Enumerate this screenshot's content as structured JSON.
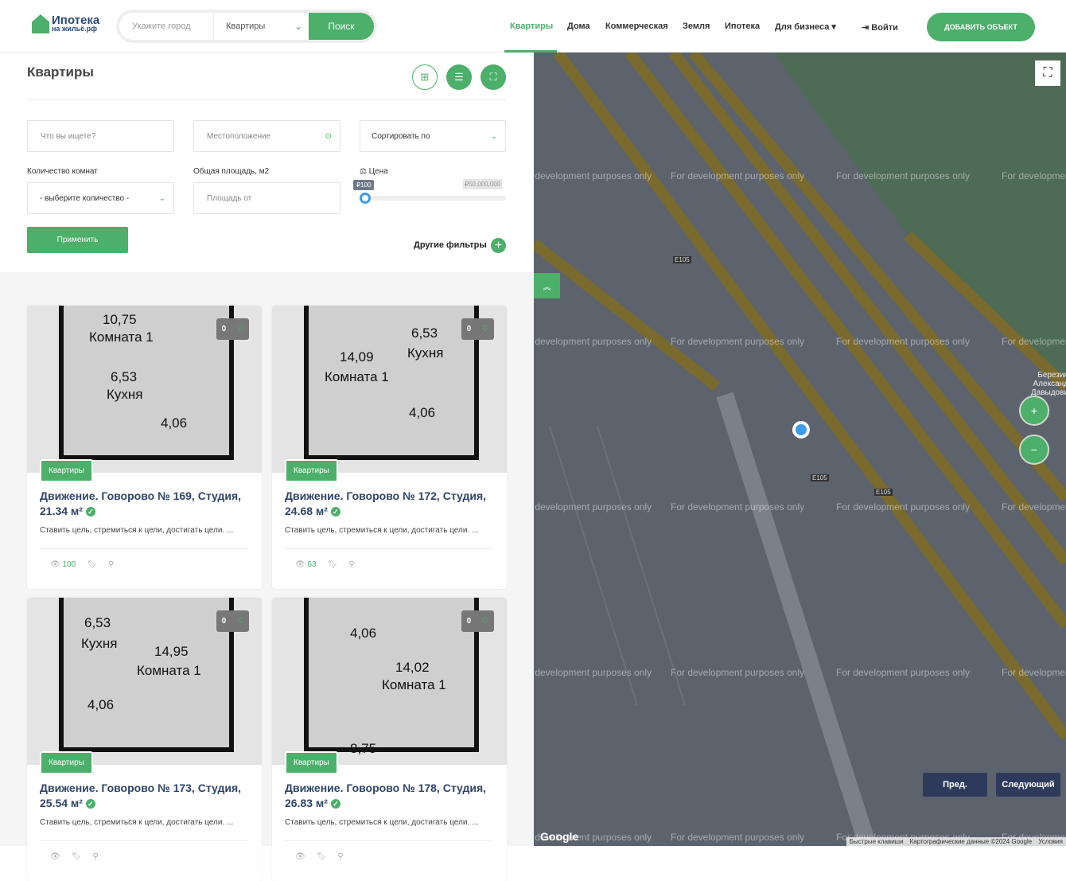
{
  "header": {
    "logo_line1": "Ипотека",
    "logo_line2": "на жильё.рф",
    "city_placeholder": "Укажите город",
    "type_value": "Квартиры",
    "search_label": "Поиск",
    "nav": [
      "Квартиры",
      "Дома",
      "Коммерческая",
      "Земля",
      "Ипотека",
      "Для бизнеса"
    ],
    "login": "Войти",
    "add": "ДОБАВИТЬ ОБЪЕКТ"
  },
  "filters": {
    "title": "Квартиры",
    "what_placeholder": "Что вы ищете?",
    "location_placeholder": "Местоположение",
    "sort": "Сортировать по",
    "rooms_label": "Количество комнат",
    "rooms_value": "- выберите количество -",
    "area_label": "Общая площадь, м2",
    "area_placeholder": "Площадь от",
    "price_label": "Цена",
    "price_min": "₽100",
    "price_max": "₽50,000,000",
    "price_fraction": 0,
    "apply": "Применить",
    "other": "Другие фильтры"
  },
  "cards": [
    {
      "tag": "Квартиры",
      "title": "Движение. Говорово № 169, Студия, 21.34 м²",
      "desc": "Ставить цель, стремиться к цели, достигать цели. ...",
      "views": "100",
      "fav": "0",
      "plan": [
        "10,75",
        "Комната 1",
        "6,53",
        "Кухня",
        "4,06"
      ]
    },
    {
      "tag": "Квартиры",
      "title": "Движение. Говорово № 172, Студия, 24.68 м²",
      "desc": "Ставить цель, стремиться к цели, достигать цели. ...",
      "views": "63",
      "fav": "0",
      "plan": [
        "14,09",
        "Комната 1",
        "6,53",
        "Кухня",
        "4,06"
      ]
    },
    {
      "tag": "Квартиры",
      "title": "Движение. Говорово № 173, Студия, 25.54 м²",
      "desc": "Ставить цель, стремиться к цели, достигать цели. ...",
      "views": "",
      "fav": "0",
      "plan": [
        "6,53",
        "Кухня",
        "14,95",
        "Комната 1",
        "4,06"
      ]
    },
    {
      "tag": "Квартиры",
      "title": "Движение. Говорово № 178, Студия, 26.83 м²",
      "desc": "Ставить цель, стремиться к цели, достигать цели. ...",
      "views": "",
      "fav": "0",
      "plan": [
        "4,06",
        "14,02",
        "Комната 1",
        "8,75",
        ""
      ]
    }
  ],
  "map": {
    "watermark": "For development purposes only",
    "road": "E105",
    "place": "Березин Александ Давыдови",
    "prev": "Пред.",
    "next": "Следующий",
    "google": "Google",
    "attribution": [
      "Быстрые клавиши",
      "Картографические данные ©2024 Google",
      "Условия"
    ]
  }
}
